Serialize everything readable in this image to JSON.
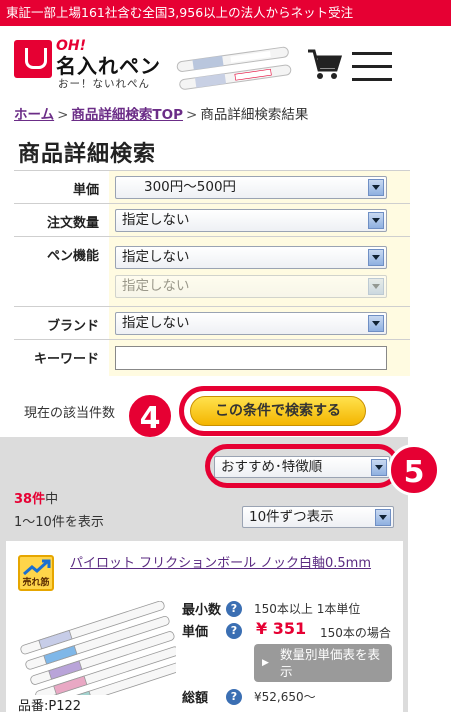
{
  "topbar": {
    "text": "東証一部上場161社含む全国3,956以上の法人からネット受注"
  },
  "logo": {
    "oh": "OH!",
    "name": "名入れペン",
    "sub": "おー！ないれぺん"
  },
  "breadcrumb": {
    "home": "ホーム",
    "top": "商品詳細検索TOP",
    "current": "商品詳細検索結果"
  },
  "page_title": "商品詳細検索",
  "form": {
    "price_label": "単価",
    "price_value": "300円〜500円",
    "order_label": "注文数量",
    "order_value": "指定しない",
    "pen_label": "ペン機能",
    "pen_value": "指定しない",
    "pen_value2": "指定しない",
    "brand_label": "ブランド",
    "brand_value": "指定しない",
    "keyword_label": "キーワード",
    "keyword_value": ""
  },
  "count_label": "現在の該当件数",
  "search_button": "この条件で検索する",
  "badges": {
    "b4": "4",
    "b5": "5"
  },
  "sort": {
    "value": "おすすめ･特徴順"
  },
  "results": {
    "count": "38件",
    "count_suffix": "中",
    "range": "1〜10件を表示",
    "per_page": "10件ずつ表示"
  },
  "product": {
    "badge": "売れ筋",
    "name": "パイロット フリクションボール ノック白軸0.5mm",
    "code": "品番:P122",
    "min_label": "最小数",
    "min_value": "150本以上 1本単位",
    "unit_label": "単価",
    "price": "¥ 351",
    "price_note": "150本の場合",
    "table_button": "数量別単価表を表示",
    "total_label": "総額",
    "total_value": "¥52,650〜"
  },
  "colors": {
    "brand_red": "#e60033",
    "link_purple": "#6b2d87",
    "form_bg": "#fffbe1"
  },
  "icons": [
    "cart-icon",
    "menu-icon",
    "question-icon",
    "trend-icon"
  ]
}
